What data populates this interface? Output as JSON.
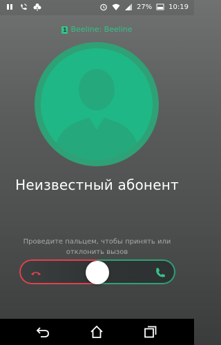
{
  "status_bar": {
    "time": "10:19",
    "battery_percent": "27%",
    "icons_left": [
      "pause-icon",
      "phone-wifi-icon",
      "clover-icon"
    ],
    "icons_right": [
      "alarm-icon",
      "wifi-icon",
      "signal-icon",
      "battery-icon"
    ]
  },
  "call": {
    "carrier": "Beeline: Beeline",
    "sim_slot": "1",
    "caller_name": "Неизвестный абонент",
    "hint": "Проведите пальцем, чтобы принять или отклонить вызов"
  },
  "colors": {
    "accent": "#2fa176",
    "avatar": "#1fb786",
    "decline": "#e0414f"
  },
  "navbar": {
    "buttons": [
      "back-icon",
      "home-icon",
      "recents-icon"
    ]
  }
}
